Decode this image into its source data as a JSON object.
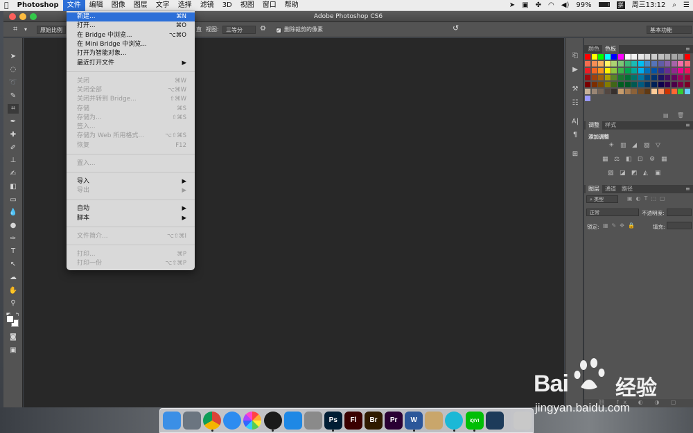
{
  "menubar": {
    "app": "Photoshop",
    "items": [
      "文件",
      "编辑",
      "图像",
      "图层",
      "文字",
      "选择",
      "滤镜",
      "3D",
      "视图",
      "窗口",
      "帮助"
    ],
    "battery": "99%",
    "input_method": "拼",
    "clock": "周三13:12"
  },
  "window": {
    "title": "Adobe Photoshop CS6"
  },
  "options_bar": {
    "ratio_label": "原始比例",
    "straighten_tail": "直",
    "view_label": "视图:",
    "view_value": "三等分",
    "delete_cropped_label": "删除裁剪的像素",
    "workspace": "基本功能"
  },
  "file_menu": {
    "items": [
      {
        "label": "新建...",
        "shortcut": "⌘N",
        "state": "highlight"
      },
      {
        "label": "打开...",
        "shortcut": "⌘O",
        "state": "enabled"
      },
      {
        "label": "在 Bridge 中浏览...",
        "shortcut": "⌥⌘O",
        "state": "enabled"
      },
      {
        "label": "在 Mini Bridge 中浏览...",
        "shortcut": "",
        "state": "enabled"
      },
      {
        "label": "打开为智能对象...",
        "shortcut": "",
        "state": "enabled"
      },
      {
        "label": "最近打开文件",
        "shortcut": "▶",
        "state": "enabled"
      },
      {
        "label": "关闭",
        "shortcut": "⌘W",
        "state": "disabled"
      },
      {
        "label": "关闭全部",
        "shortcut": "⌥⌘W",
        "state": "disabled"
      },
      {
        "label": "关闭并转到 Bridge...",
        "shortcut": "⇧⌘W",
        "state": "disabled"
      },
      {
        "label": "存储",
        "shortcut": "⌘S",
        "state": "disabled"
      },
      {
        "label": "存储为...",
        "shortcut": "⇧⌘S",
        "state": "disabled"
      },
      {
        "label": "签入...",
        "shortcut": "",
        "state": "disabled"
      },
      {
        "label": "存储为 Web 所用格式...",
        "shortcut": "⌥⇧⌘S",
        "state": "disabled"
      },
      {
        "label": "恢复",
        "shortcut": "F12",
        "state": "disabled"
      },
      {
        "label": "置入...",
        "shortcut": "",
        "state": "disabled"
      },
      {
        "label": "导入",
        "shortcut": "▶",
        "state": "enabled"
      },
      {
        "label": "导出",
        "shortcut": "▶",
        "state": "disabled"
      },
      {
        "label": "自动",
        "shortcut": "▶",
        "state": "enabled"
      },
      {
        "label": "脚本",
        "shortcut": "▶",
        "state": "enabled"
      },
      {
        "label": "文件简介...",
        "shortcut": "⌥⇧⌘I",
        "state": "disabled"
      },
      {
        "label": "打印...",
        "shortcut": "⌘P",
        "state": "disabled"
      },
      {
        "label": "打印一份",
        "shortcut": "⌥⇧⌘P",
        "state": "disabled"
      }
    ]
  },
  "swatches_panel": {
    "tabs": [
      "颜色",
      "色板"
    ],
    "active_tab": "色板",
    "colors": [
      "#ff0000",
      "#ffff00",
      "#00ff00",
      "#00ffff",
      "#0000ff",
      "#ff00ff",
      "#ffffff",
      "#f2f2f2",
      "#e6e6e6",
      "#d9d9d9",
      "#cccccc",
      "#bfbfbf",
      "#b3b3b3",
      "#a6a6a6",
      "#999999",
      "#ff0000",
      "#f26c4f",
      "#f68e55",
      "#fbaf5c",
      "#fff467",
      "#acd372",
      "#7cc576",
      "#3bb878",
      "#1abbb4",
      "#00bff3",
      "#438ccb",
      "#5574b9",
      "#605ca8",
      "#855fa8",
      "#a763a8",
      "#f06ea9",
      "#f26d7d",
      "#ed1c24",
      "#f26522",
      "#f7941d",
      "#fff200",
      "#8dc63f",
      "#39b54a",
      "#00a651",
      "#00a99d",
      "#00aeef",
      "#0072bc",
      "#0054a6",
      "#2e3192",
      "#662d91",
      "#92278f",
      "#ec008c",
      "#ed145b",
      "#9e0b0f",
      "#a0410d",
      "#a36209",
      "#aba000",
      "#598527",
      "#197b30",
      "#007236",
      "#00746b",
      "#0076a3",
      "#004b80",
      "#003471",
      "#1b1464",
      "#440e62",
      "#630460",
      "#9e005d",
      "#9e0039",
      "#790000",
      "#7b2e00",
      "#7d4900",
      "#827b00",
      "#406618",
      "#005e20",
      "#005826",
      "#005952",
      "#005b7f",
      "#003663",
      "#002157",
      "#0d004c",
      "#32004b",
      "#4b0049",
      "#7b0046",
      "#7a0026",
      "#c7b299",
      "#998675",
      "#736357",
      "#534741",
      "#37302d",
      "#c69c6d",
      "#a67c52",
      "#8c6239",
      "#754c24",
      "#603913",
      "#ffcc99",
      "#ff9966",
      "#cc3300",
      "#ff6633",
      "#33cc33",
      "#66ccff",
      "#9999ff"
    ]
  },
  "adjustments_panel": {
    "tabs": [
      "调整",
      "样式"
    ],
    "active_tab": "调整",
    "heading": "添加调整"
  },
  "layers_panel": {
    "tabs": [
      "图层",
      "通道",
      "路径"
    ],
    "active_tab": "图层",
    "filter_kind": "类型",
    "blend_mode": "正常",
    "opacity_label": "不透明度:",
    "lock_label": "锁定:",
    "fill_label": "填充:"
  },
  "dock": {
    "apps": [
      {
        "name": "finder",
        "label": "",
        "color": "#3b8fe6"
      },
      {
        "name": "launchpad",
        "label": "",
        "color": "#6b7580"
      },
      {
        "name": "chrome",
        "label": "",
        "color": "#e8eaed"
      },
      {
        "name": "safari",
        "label": "",
        "color": "#2d8cf0"
      },
      {
        "name": "photos",
        "label": "",
        "color": "#f2f2f2"
      },
      {
        "name": "qq",
        "label": "",
        "color": "#1a1a1a"
      },
      {
        "name": "app-store",
        "label": "",
        "color": "#1e88e5"
      },
      {
        "name": "system-preferences",
        "label": "",
        "color": "#8a8a8a"
      },
      {
        "name": "photoshop",
        "label": "Ps",
        "color": "#001d34"
      },
      {
        "name": "flash",
        "label": "Fl",
        "color": "#3a0000"
      },
      {
        "name": "bridge",
        "label": "Br",
        "color": "#2f1a00"
      },
      {
        "name": "premiere",
        "label": "Pr",
        "color": "#2a0033"
      },
      {
        "name": "word",
        "label": "W",
        "color": "#2b579a"
      },
      {
        "name": "archive",
        "label": "",
        "color": "#c9a66b"
      },
      {
        "name": "wechat-reader",
        "label": "",
        "color": "#1bb8d6"
      },
      {
        "name": "iqiyi",
        "label": "iQIYI",
        "color": "#00be06"
      },
      {
        "name": "quicktime",
        "label": "",
        "color": "#1d3b5a"
      },
      {
        "name": "trash",
        "label": "",
        "color": "#c8c8c8"
      }
    ]
  },
  "watermark": {
    "brand_a": "Bai",
    "brand_b": "经验",
    "url": "jingyan.baidu.com"
  }
}
